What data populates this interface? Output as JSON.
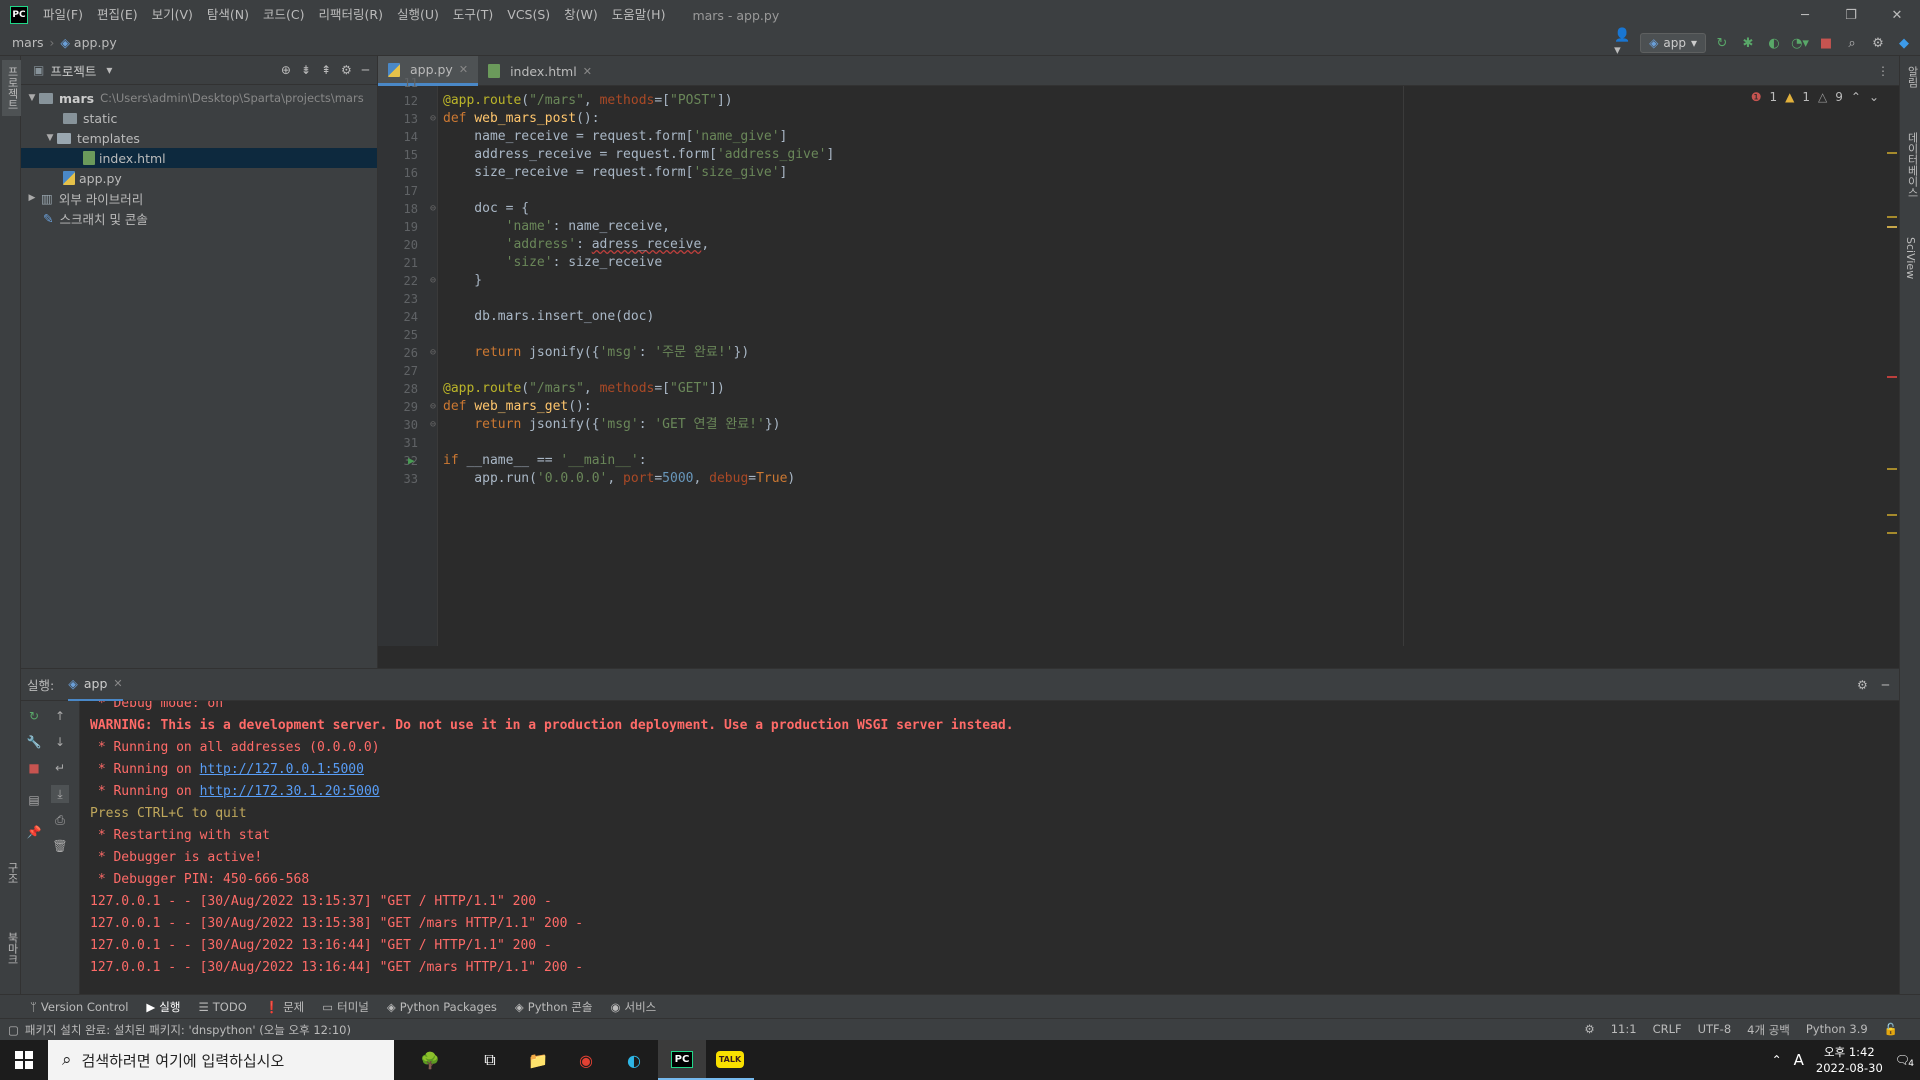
{
  "menu": {
    "logo": "PC",
    "items": [
      "파일(F)",
      "편집(E)",
      "보기(V)",
      "탐색(N)",
      "코드(C)",
      "리팩터링(R)",
      "실행(U)",
      "도구(T)",
      "VCS(S)",
      "창(W)",
      "도움말(H)"
    ],
    "window_title": "mars - app.py"
  },
  "breadcrumb": {
    "project": "mars",
    "file": "app.py"
  },
  "toolbar": {
    "run_config": "app"
  },
  "left_strip": {
    "tab1": "프로젝트",
    "tab2": "구조",
    "tab3": "북마크"
  },
  "right_strip": {
    "tab1": "알림",
    "tab2": "데이터베이스",
    "tab3": "SciView"
  },
  "project_panel": {
    "title": "프로젝트",
    "root_name": "mars",
    "root_path": "C:\\Users\\admin\\Desktop\\Sparta\\projects\\mars",
    "static": "static",
    "templates": "templates",
    "index_html": "index.html",
    "app_py": "app.py",
    "external_libs": "외부 라이브러리",
    "scratches": "스크래치 및 콘솔"
  },
  "editor_tabs": {
    "tab1": "app.py",
    "tab2": "index.html"
  },
  "inspections": {
    "errors": "1",
    "warnings": "1",
    "weak": "9"
  },
  "code_lines": [
    {
      "n": "11",
      "t": ""
    },
    {
      "n": "12",
      "t": "@app.route(\"/mars\", methods=[\"POST\"])"
    },
    {
      "n": "13",
      "t": "def web_mars_post():"
    },
    {
      "n": "14",
      "t": "    name_receive = request.form['name_give']"
    },
    {
      "n": "15",
      "t": "    address_receive = request.form['address_give']"
    },
    {
      "n": "16",
      "t": "    size_receive = request.form['size_give']"
    },
    {
      "n": "17",
      "t": ""
    },
    {
      "n": "18",
      "t": "    doc = {"
    },
    {
      "n": "19",
      "t": "        'name': name_receive,"
    },
    {
      "n": "20",
      "t": "        'address': adress_receive,"
    },
    {
      "n": "21",
      "t": "        'size': size_receive"
    },
    {
      "n": "22",
      "t": "    }"
    },
    {
      "n": "23",
      "t": ""
    },
    {
      "n": "24",
      "t": "    db.mars.insert_one(doc)"
    },
    {
      "n": "25",
      "t": ""
    },
    {
      "n": "26",
      "t": "    return jsonify({'msg': '주문 완료!'})"
    },
    {
      "n": "27",
      "t": ""
    },
    {
      "n": "28",
      "t": "@app.route(\"/mars\", methods=[\"GET\"])"
    },
    {
      "n": "29",
      "t": "def web_mars_get():"
    },
    {
      "n": "30",
      "t": "    return jsonify({'msg': 'GET 연결 완료!'})"
    },
    {
      "n": "31",
      "t": ""
    },
    {
      "n": "32",
      "t": "if __name__ == '__main__':"
    },
    {
      "n": "33",
      "t": "    app.run('0.0.0.0', port=5000, debug=True)"
    }
  ],
  "run_panel": {
    "label": "실행:",
    "tab": "app",
    "console": [
      " * Debug mode: on",
      "WARNING: This is a development server. Do not use it in a production deployment. Use a production WSGI server instead.",
      " * Running on all addresses (0.0.0.0)",
      " * Running on ",
      " * Running on ",
      "Press CTRL+C to quit",
      " * Restarting with stat",
      " * Debugger is active!",
      " * Debugger PIN: 450-666-568",
      "127.0.0.1 - - [30/Aug/2022 13:15:37] \"GET / HTTP/1.1\" 200 -",
      "127.0.0.1 - - [30/Aug/2022 13:15:38] \"GET /mars HTTP/1.1\" 200 -",
      "127.0.0.1 - - [30/Aug/2022 13:16:44] \"GET / HTTP/1.1\" 200 -",
      "127.0.0.1 - - [30/Aug/2022 13:16:44] \"GET /mars HTTP/1.1\" 200 -"
    ],
    "link1": "http://127.0.0.1:5000",
    "link2": "http://172.30.1.20:5000"
  },
  "bottom_tabs": [
    "Version Control",
    "실행",
    "TODO",
    "문제",
    "터미널",
    "Python Packages",
    "Python 콘솔",
    "서비스"
  ],
  "status": {
    "message": "패키지 설치 완료: 설치된 패키지: 'dnspython' (오늘 오후 12:10)",
    "position": "11:1",
    "line_sep": "CRLF",
    "encoding": "UTF-8",
    "indent": "4개 공백",
    "interpreter": "Python 3.9"
  },
  "taskbar": {
    "search_placeholder": "검색하려면 여기에 입력하십시오",
    "ime": "A",
    "time": "오후 1:42",
    "date": "2022-08-30",
    "notif_count": "4"
  },
  "colors": {
    "keyword": "#cc7832",
    "string": "#6a8759",
    "function": "#ffc66d",
    "decorator": "#bbb529",
    "number": "#6897bb",
    "console_red": "#ff6b68"
  }
}
